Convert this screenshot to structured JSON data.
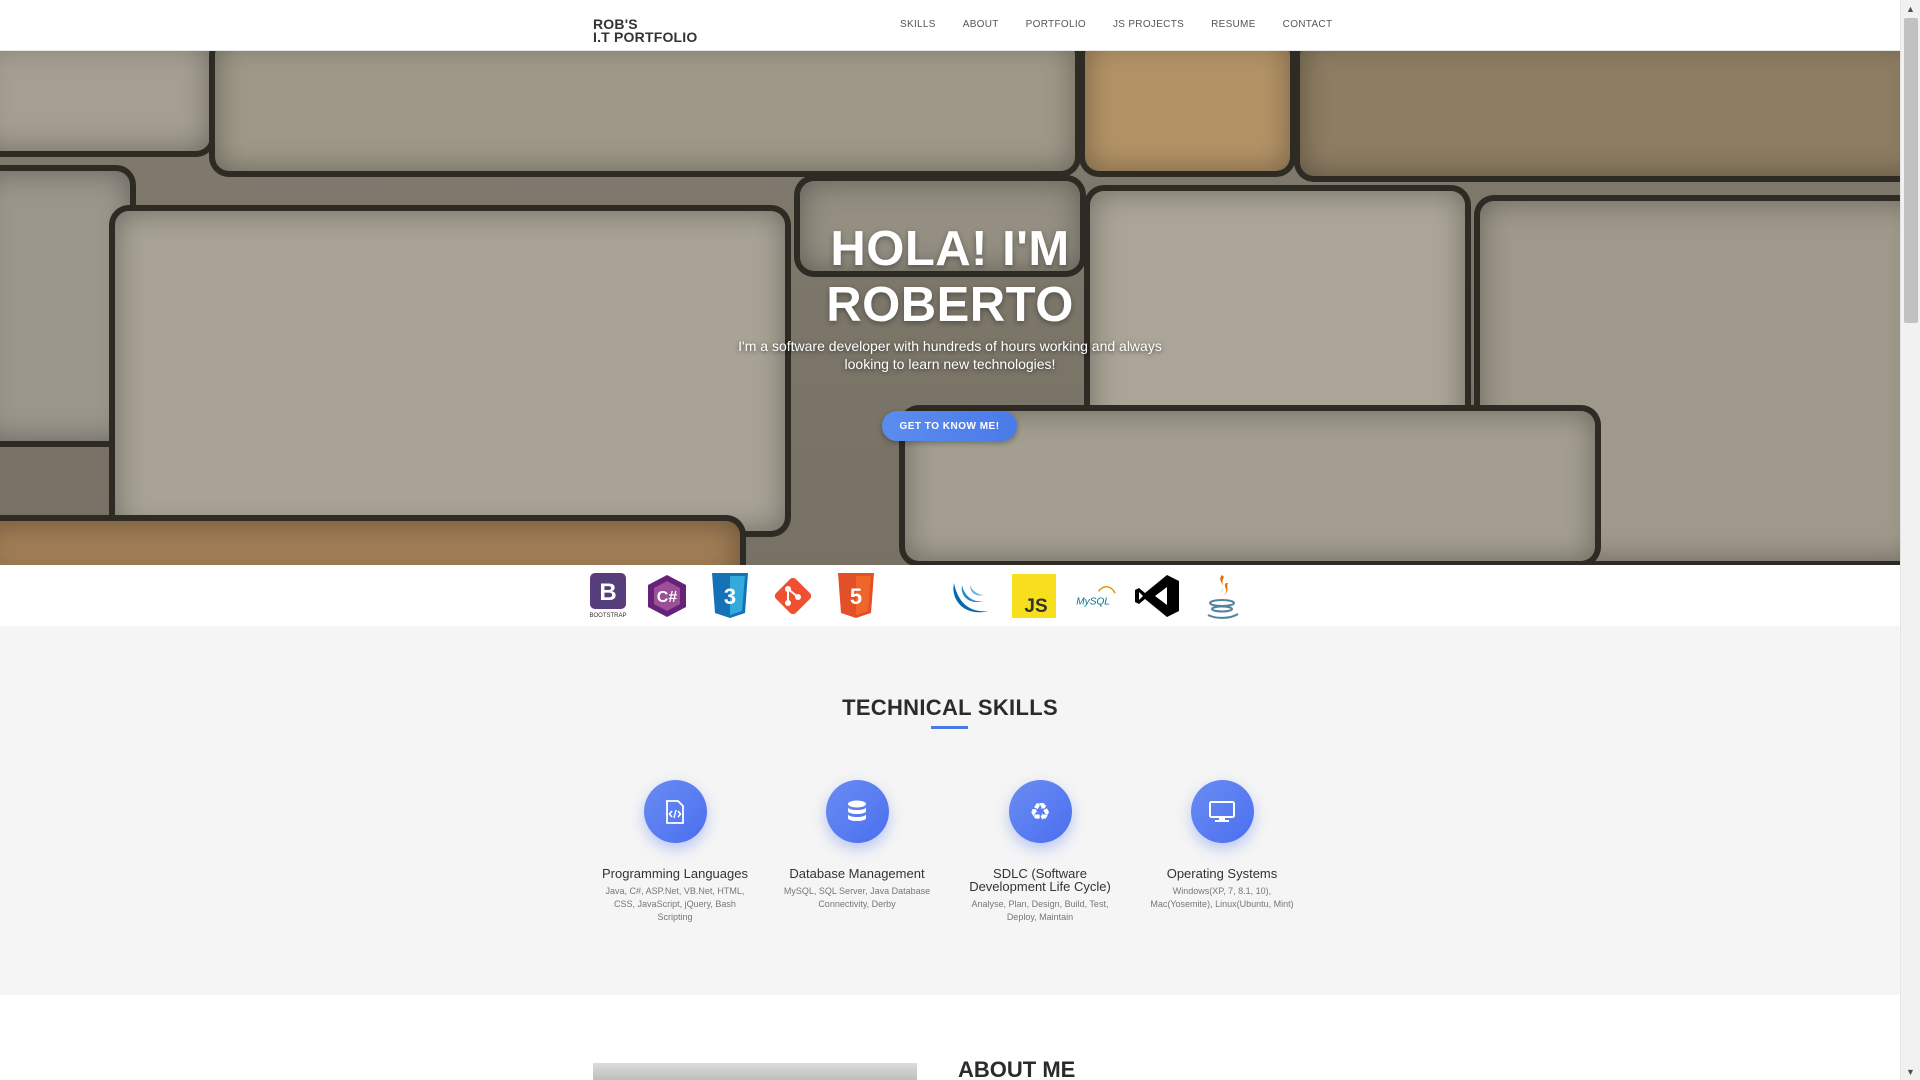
{
  "navbar": {
    "brand_line1": "ROB'S",
    "brand_line2": "I.T PORTFOLIO",
    "links": [
      "SKILLS",
      "ABOUT",
      "PORTFOLIO",
      "JS PROJECTS",
      "RESUME",
      "CONTACT"
    ]
  },
  "hero": {
    "title_line1": "HOLA! I'M",
    "title_line2": "ROBERTO",
    "subtitle_line1": "I'm a software developer with hundreds of hours working and always",
    "subtitle_line2": "looking to learn new technologies!",
    "cta_label": "GET TO KNOW ME!",
    "background_icon": "stone-wall-image"
  },
  "tech_logos": [
    {
      "icon": "bootstrap-icon",
      "label": "B",
      "caption": "BOOTSTRAP",
      "color": "#563d7c"
    },
    {
      "icon": "csharp-icon",
      "label": "C#",
      "color": "#68217a"
    },
    {
      "icon": "css3-icon",
      "label": "3",
      "color": "#1572b6"
    },
    {
      "icon": "git-icon",
      "color": "#f05032"
    },
    {
      "icon": "html5-icon",
      "label": "5",
      "color": "#e34f26"
    },
    {
      "icon": "jquery-icon",
      "color": "#0769ad"
    },
    {
      "icon": "javascript-icon",
      "label": "JS",
      "color": "#f7df1e"
    },
    {
      "icon": "mysql-icon",
      "label": "MySQL",
      "color": "#00758f"
    },
    {
      "icon": "visual-studio-icon",
      "color": "#000000"
    },
    {
      "icon": "java-icon",
      "color": "#e76f00"
    }
  ],
  "skills": {
    "title": "TECHNICAL SKILLS",
    "accent_color": "#4a7ae8",
    "items": [
      {
        "icon": "code-file-icon",
        "name": "Programming Languages",
        "desc": "Java, C#, ASP.Net, VB.Net, HTML, CSS, JavaScript, jQuery, Bash Scripting"
      },
      {
        "icon": "database-icon",
        "name": "Database Management",
        "desc": "MySQL, SQL Server, Java Database Connectivity, Derby"
      },
      {
        "icon": "recycle-icon",
        "name": "SDLC (Software Development Life Cycle)",
        "desc": "Analyse, Plan, Design, Build, Test, Deploy, Maintain"
      },
      {
        "icon": "monitor-icon",
        "name": "Operating Systems",
        "desc": "Windows(XP, 7, 8.1, 10), Mac(Yosemite), Linux(Ubuntu, Mint)"
      }
    ]
  },
  "about": {
    "title": "ABOUT ME"
  }
}
